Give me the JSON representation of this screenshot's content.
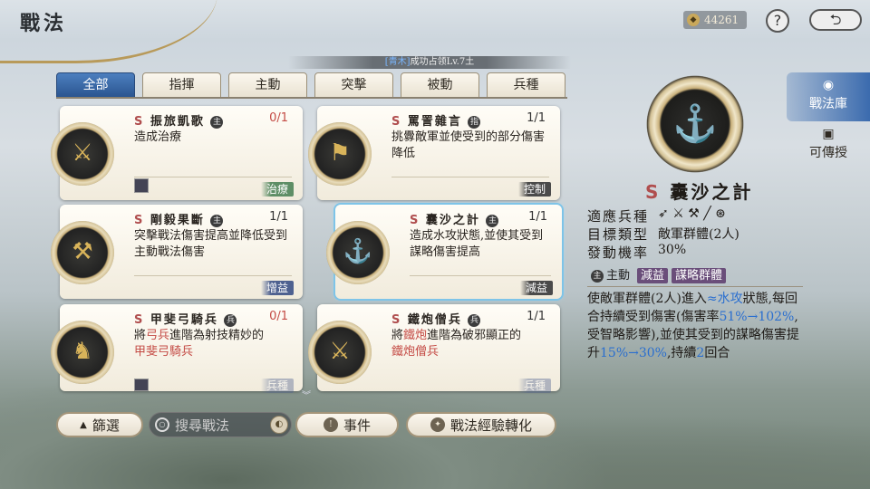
{
  "header": {
    "title": "戰法",
    "currency": "44261",
    "help": "?",
    "back": "⮌"
  },
  "ticker": {
    "prefix": "[青木]",
    "text": "成功占领Lv.7土"
  },
  "tabs": [
    "全部",
    "指揮",
    "主動",
    "突擊",
    "被動",
    "兵種"
  ],
  "cards": [
    {
      "name": "振旅凱歌",
      "badge": "主",
      "count": "0/1",
      "count_red": true,
      "desc": "造成治療",
      "tag": "治療",
      "tag_color": "green",
      "glyph": "⚔"
    },
    {
      "name": "罵詈雜言",
      "badge": "指",
      "count": "1/1",
      "count_red": false,
      "desc": "挑釁敵軍並使受到的部分傷害降低",
      "tag": "控制",
      "tag_color": "gray",
      "glyph": "⚑"
    },
    {
      "name": "剛毅果斷",
      "badge": "主",
      "count": "1/1",
      "count_red": false,
      "desc": "突擊戰法傷害提高並降低受到主動戰法傷害",
      "tag": "增益",
      "tag_color": "blue",
      "glyph": "⚒"
    },
    {
      "name": "囊沙之計",
      "badge": "主",
      "count": "1/1",
      "count_red": false,
      "desc": "造成水攻狀態,並使其受到謀略傷害提高",
      "tag": "減益",
      "tag_color": "gray",
      "glyph": "⚓"
    },
    {
      "name": "甲斐弓騎兵",
      "badge": "兵",
      "count": "0/1",
      "count_red": true,
      "desc_pre": "將",
      "desc_red1": "弓兵",
      "desc_mid": "進階為射技精妙的",
      "desc_red2": "甲斐弓騎兵",
      "tag": "兵種",
      "tag_color": "blue",
      "glyph": "♞"
    },
    {
      "name": "鐵炮僧兵",
      "badge": "兵",
      "count": "1/1",
      "count_red": false,
      "desc_pre": "將",
      "desc_red1": "鐵炮",
      "desc_mid": "進階為破邪顯正的",
      "desc_red2": "鐵炮僧兵",
      "tag": "兵種",
      "tag_color": "blue",
      "glyph": "⚔"
    }
  ],
  "bottom": {
    "filter": "篩選",
    "search_placeholder": "搜尋戰法",
    "event": "事件",
    "convert": "戰法經驗轉化"
  },
  "side": [
    {
      "label": "戰法庫",
      "icon": "◉"
    },
    {
      "label": "可傳授",
      "icon": "▣"
    }
  ],
  "detail": {
    "rank": "S",
    "name": "囊沙之計",
    "rows": [
      {
        "k": "適應兵種",
        "v": "➶ ⚔ ⚒ ╱ ⊛"
      },
      {
        "k": "目標類型",
        "v": "敵軍群體(2人)"
      },
      {
        "k": "發動機率",
        "v": "30%"
      }
    ],
    "type": "主動",
    "type_badge": "主",
    "tags": [
      "減益",
      "謀略群體"
    ],
    "desc_a": "使敵軍群體(2人)進入",
    "desc_water": "≈水攻",
    "desc_b": "狀態,每回合持續受到傷害(傷害率",
    "desc_rate1": "51%→102%",
    "desc_c": ",受智略影響),並使其受到的謀略傷害提升",
    "desc_rate2": "15%→30%",
    "desc_d": ",持續",
    "desc_turns": "2",
    "desc_e": "回合"
  },
  "colors": {
    "accent_blue": "#3b6bae",
    "red": "#c44b45",
    "gold": "#c9b07a"
  }
}
